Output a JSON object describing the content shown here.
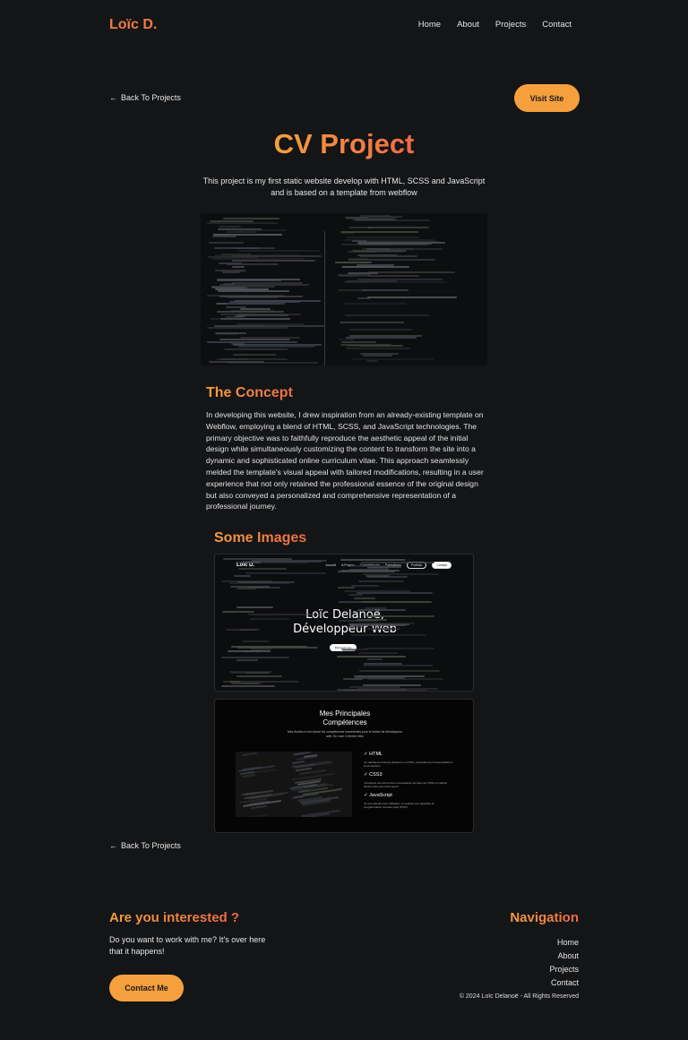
{
  "header": {
    "logo": "Loïc D.",
    "nav": [
      "Home",
      "About",
      "Projects",
      "Contact"
    ]
  },
  "back_link": "Back To Projects",
  "visit_button": "Visit Site",
  "title": "CV Project",
  "subtitle": "This project is my first static website develop with HTML, SCSS and JavaScript and is based on a template from webflow",
  "concept": {
    "heading": "The Concept",
    "text": "In developing this website, I drew inspiration from an already-existing template on Webflow, employing a blend of HTML, SCSS, and JavaScript technologies. The primary objective was to faithfully reproduce the aesthetic appeal of the initial design while simultaneously customizing the content to transform the site into a dynamic and sophisticated online curriculum vitae. This approach seamlessly melded the template's visual appeal with tailored modifications, resulting in a user experience that not only retained the professional essence of the original design but also conveyed a personalized and comprehensive representation of a professional journey."
  },
  "images_heading": "Some Images",
  "shot1": {
    "logo": "Loïc D.",
    "nav": [
      "Accueil",
      "A Propos",
      "Compétences",
      "Formations"
    ],
    "pill_outline": "Portfolio",
    "pill_fill": "Contact",
    "hero_line1": "Loïc Delanoë,",
    "hero_line2": "Développeur Web",
    "button": "Découvrir moi"
  },
  "shot2": {
    "title_line1": "Mes Principales",
    "title_line2": "Compétences",
    "subtitle": "Mes études m'ont donné les compétences essentielles pour le métier de développeur web. En voici 3 d'entre elles",
    "skills": [
      {
        "name": "HTML",
        "desc": "Je maîtrise les bonnes pratiques en HTML, principalement l'accessibilité et la sémantique"
      },
      {
        "name": "CSS3",
        "desc": "J'ai acquis une très bonne connaissance de base de CSS3 et maîtrise flexbox ainsi que Grid Layout"
      },
      {
        "name": "JavaScript",
        "desc": "Je suis attentif à son utilisation, et exploite ses capacités en programmation orientée objet (POO)"
      }
    ]
  },
  "footer": {
    "interest_heading": "Are you interested ?",
    "interest_text": "Do you want to work with me? It's over here that it happens!",
    "contact_button": "Contact Me",
    "nav_heading": "Navigation",
    "nav": [
      "Home",
      "About",
      "Projects",
      "Contact"
    ],
    "copyright": "© 2024 Loïc Delanoë - All Rights Reserved"
  },
  "colors": {
    "background": "#141517",
    "accent_orange": "#f6a03d",
    "accent_red": "#ee6a45"
  }
}
